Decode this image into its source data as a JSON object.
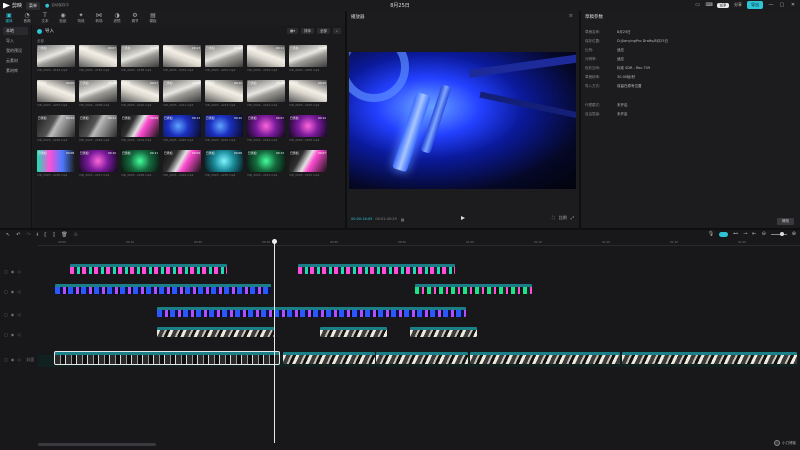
{
  "app": {
    "name": "剪映",
    "menu_label": "菜单",
    "autosave": "自动保存中",
    "project_title": "8月25日",
    "vip_label": "VIP",
    "share_label": "分享",
    "export_label": "导出"
  },
  "media_tabs": [
    {
      "label": "媒体",
      "icon": "media-icon",
      "active": true
    },
    {
      "label": "音频",
      "icon": "audio-icon"
    },
    {
      "label": "文本",
      "icon": "text-icon"
    },
    {
      "label": "贴纸",
      "icon": "sticker-icon"
    },
    {
      "label": "特效",
      "icon": "effects-icon"
    },
    {
      "label": "转场",
      "icon": "transition-icon"
    },
    {
      "label": "滤镜",
      "icon": "filter-icon"
    },
    {
      "label": "调节",
      "icon": "adjust-icon"
    },
    {
      "label": "模板",
      "icon": "template-icon"
    }
  ],
  "media_side": [
    {
      "label": "本地",
      "active": true
    },
    {
      "label": "导入"
    },
    {
      "label": "我的预设"
    },
    {
      "label": "云素材"
    },
    {
      "label": "素材库"
    }
  ],
  "media_body": {
    "import_label": "导入",
    "sort_label": "排序",
    "filter_label": "全部",
    "section_label": "全部"
  },
  "thumbs": [
    {
      "tag": "已添加",
      "dur": "00:17",
      "cap": "VID_2023...2154.mp4",
      "style": "t-white"
    },
    {
      "tag": "已添加",
      "dur": "00:07",
      "cap": "VID_2023...2156.mp4",
      "style": "t-white2"
    },
    {
      "tag": "已添加",
      "dur": "00:06",
      "cap": "VID_2023...2158.mp4",
      "style": "t-white"
    },
    {
      "tag": "已添加",
      "dur": "00:13",
      "cap": "VID_2023...2159.mp4",
      "style": "t-white2"
    },
    {
      "tag": "已添加",
      "dur": "00:10",
      "cap": "VID_2023...2201.mp4",
      "style": "t-white"
    },
    {
      "tag": "已添加",
      "dur": "00:11",
      "cap": "VID_2023...2203.mp4",
      "style": "t-white2"
    },
    {
      "tag": "已添加",
      "dur": "00:08",
      "cap": "VID_2023...2205.mp4",
      "style": "t-white"
    },
    {
      "tag": "已添加",
      "dur": "00:09",
      "cap": "VID_2023...2207.mp4",
      "style": "t-white2"
    },
    {
      "tag": "已添加",
      "dur": "00:12",
      "cap": "VID_2023...2208.mp4",
      "style": "t-white"
    },
    {
      "tag": "已添加",
      "dur": "00:07",
      "cap": "VID_2023...2210.mp4",
      "style": "t-white2"
    },
    {
      "tag": "已添加",
      "dur": "00:06",
      "cap": "VID_2023...2211.mp4",
      "style": "t-white"
    },
    {
      "tag": "已添加",
      "dur": "00:10",
      "cap": "VID_2023...2213.mp4",
      "style": "t-white2"
    },
    {
      "tag": "已添加",
      "dur": "00:08",
      "cap": "VID_2023...2214.mp4",
      "style": "t-white"
    },
    {
      "tag": "已添加",
      "dur": "00:05",
      "cap": "VID_2023...2215.mp4",
      "style": "t-white2"
    },
    {
      "tag": "已添加",
      "dur": "00:14",
      "cap": "VID_2023...2216.mp4",
      "style": "t-dark"
    },
    {
      "tag": "已添加",
      "dur": "00:11",
      "cap": "VID_2023...2218.mp4",
      "style": "t-dark"
    },
    {
      "tag": "已添加",
      "dur": "00:09",
      "cap": "VID_2023...2219.mp4",
      "style": "t-mix"
    },
    {
      "tag": "已添加",
      "dur": "00:13",
      "cap": "VID_2023...2220.mp4",
      "style": "t-blue"
    },
    {
      "tag": "已添加",
      "dur": "00:10",
      "cap": "VID_2023...2222.mp4",
      "style": "t-blue"
    },
    {
      "tag": "已添加",
      "dur": "00:07",
      "cap": "VID_2023...2224.mp4",
      "style": "t-pink"
    },
    {
      "tag": "已添加",
      "dur": "00:12",
      "cap": "VID_2023...2225.mp4",
      "style": "t-pink"
    },
    {
      "tag": "已添加",
      "dur": "00:08",
      "cap": "VID_2023...2226.mp4",
      "style": "t-rgb"
    },
    {
      "tag": "已添加",
      "dur": "00:10",
      "cap": "VID_2023...2227.mp4",
      "style": "t-pink"
    },
    {
      "tag": "已添加",
      "dur": "00:11",
      "cap": "VID_2023...2228.mp4",
      "style": "t-green"
    },
    {
      "tag": "已添加",
      "dur": "00:09",
      "cap": "VID_2023...2229.mp4",
      "style": "t-mix"
    },
    {
      "tag": "已添加",
      "dur": "00:06",
      "cap": "VID_2023...2230.mp4",
      "style": "t-cyan"
    },
    {
      "tag": "已添加",
      "dur": "00:13",
      "cap": "VID_2023...2231.mp4",
      "style": "t-green"
    },
    {
      "tag": "已添加",
      "dur": "00:07",
      "cap": "VID_2023...2232.mp4",
      "style": "t-mix"
    }
  ],
  "player": {
    "title": "播放器",
    "timecode_current": "00:00:16:09",
    "timecode_total": "00:01:45:29",
    "ratio_label": "比例"
  },
  "details": {
    "title": "草稿参数",
    "rows": [
      {
        "k": "草稿名称:",
        "v": "8月25日"
      },
      {
        "k": "保存位置:",
        "v": "D:/JianyingPro Drafts/8月25日"
      },
      {
        "k": "比例:",
        "v": "适应"
      },
      {
        "k": "分辨率:",
        "v": "适应"
      },
      {
        "k": "色彩空间:",
        "v": "标准 SDR - Rec.709"
      },
      {
        "k": "草稿帧率:",
        "v": "30.00帧/秒"
      },
      {
        "k": "导入方式:",
        "v": "保留在原有位置"
      },
      {
        "k": "代理模式:",
        "v": "未开启"
      },
      {
        "k": "自由层级:",
        "v": "未开启"
      }
    ],
    "modify_label": "修改"
  },
  "timeline": {
    "ticks": [
      "00:00",
      "00:10",
      "00:20",
      "00:30",
      "00:40",
      "00:50",
      "01:00",
      "01:10",
      "01:20",
      "01:30",
      "01:40",
      "01:50"
    ],
    "cover_label": "封面",
    "watermark": "小刀博客"
  },
  "clips": [
    {
      "row": 0,
      "start": 70,
      "width": 157,
      "style": "c-pink",
      "label": "VID_20230825_212348.mp4   00:00:11:16"
    },
    {
      "row": 0,
      "start": 298,
      "width": 157,
      "style": "c-pink",
      "label": "VID_20230825_212348.mp4   00:00:11:16"
    },
    {
      "row": 1,
      "start": 55,
      "width": 216,
      "style": "c-blue",
      "label": "VID_20230825_212203.mp4   00:00:16:00"
    },
    {
      "row": 1,
      "start": 415,
      "width": 117,
      "style": "c-green",
      "label": "VID_20230825_212223.mp4   00:00:08:22"
    },
    {
      "row": 2,
      "start": 157,
      "width": 309,
      "style": "c-blue",
      "label": "VID_20230825_213227.mp4   00:00:23:20"
    },
    {
      "row": 3,
      "start": 157,
      "width": 117,
      "style": "c-white",
      "label": "VID_20230825_210126.mp4   00:00:04:20"
    },
    {
      "row": 3,
      "start": 320,
      "width": 67,
      "style": "c-white",
      "label": "VID_20230825_211015.mp4   00:00:05:07"
    },
    {
      "row": 3,
      "start": 410,
      "width": 67,
      "style": "c-white",
      "label": "VID_20230825_210513.mp4   00:00:05:19"
    },
    {
      "row": 4,
      "start": 55,
      "width": 224,
      "style": "c-dark",
      "label": "VID_20230825_220114.mp4   00:00:16:20",
      "sel": true
    },
    {
      "row": 4,
      "start": 283,
      "width": 92,
      "style": "c-white",
      "label": "VID_20230825_220403.mp4   00:00:06:24"
    },
    {
      "row": 4,
      "start": 376,
      "width": 92,
      "style": "c-white",
      "label": "VID_20230825_220512.mp4   00:00:06:24"
    },
    {
      "row": 4,
      "start": 470,
      "width": 150,
      "style": "c-white",
      "label": "VID_20230825_220721.mp4   00:00:12:00"
    },
    {
      "row": 4,
      "start": 622,
      "width": 175,
      "style": "c-white",
      "label": "VID_20230825_220721.mp4   00:00:13:03"
    }
  ]
}
